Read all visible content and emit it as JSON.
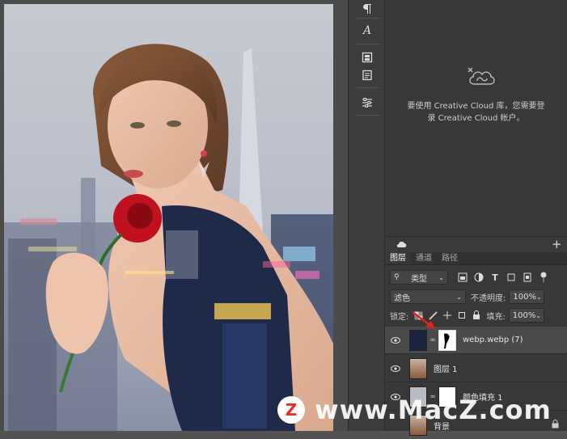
{
  "libraries": {
    "message_line1": "要使用 Creative Cloud 库，您需要登",
    "message_line2": "录 Creative Cloud 帐户。"
  },
  "layers_panel": {
    "tabs": [
      "图层",
      "通道",
      "路径"
    ],
    "active_tab": "图层",
    "filter_kind": "类型",
    "blend_mode": "滤色",
    "opacity_label": "不透明度:",
    "opacity_value": "100%",
    "lock_label": "锁定:",
    "fill_label": "填充:",
    "fill_value": "100%",
    "layers": [
      {
        "name": "webp.webp (7)",
        "selected": true
      },
      {
        "name": "图层 1",
        "selected": false
      },
      {
        "name": "颜色填充 1",
        "selected": false
      },
      {
        "name": "背景",
        "selected": false
      }
    ]
  },
  "watermark": {
    "badge_letter": "Z",
    "text": "www.MacZ.com"
  },
  "colors": {
    "panel_bg": "#383838",
    "canvas_bg": "#4b4b4b",
    "selected_row": "#4a4a4a",
    "watermark_badge": "#e03030",
    "annotation_arrow": "#e02020"
  }
}
